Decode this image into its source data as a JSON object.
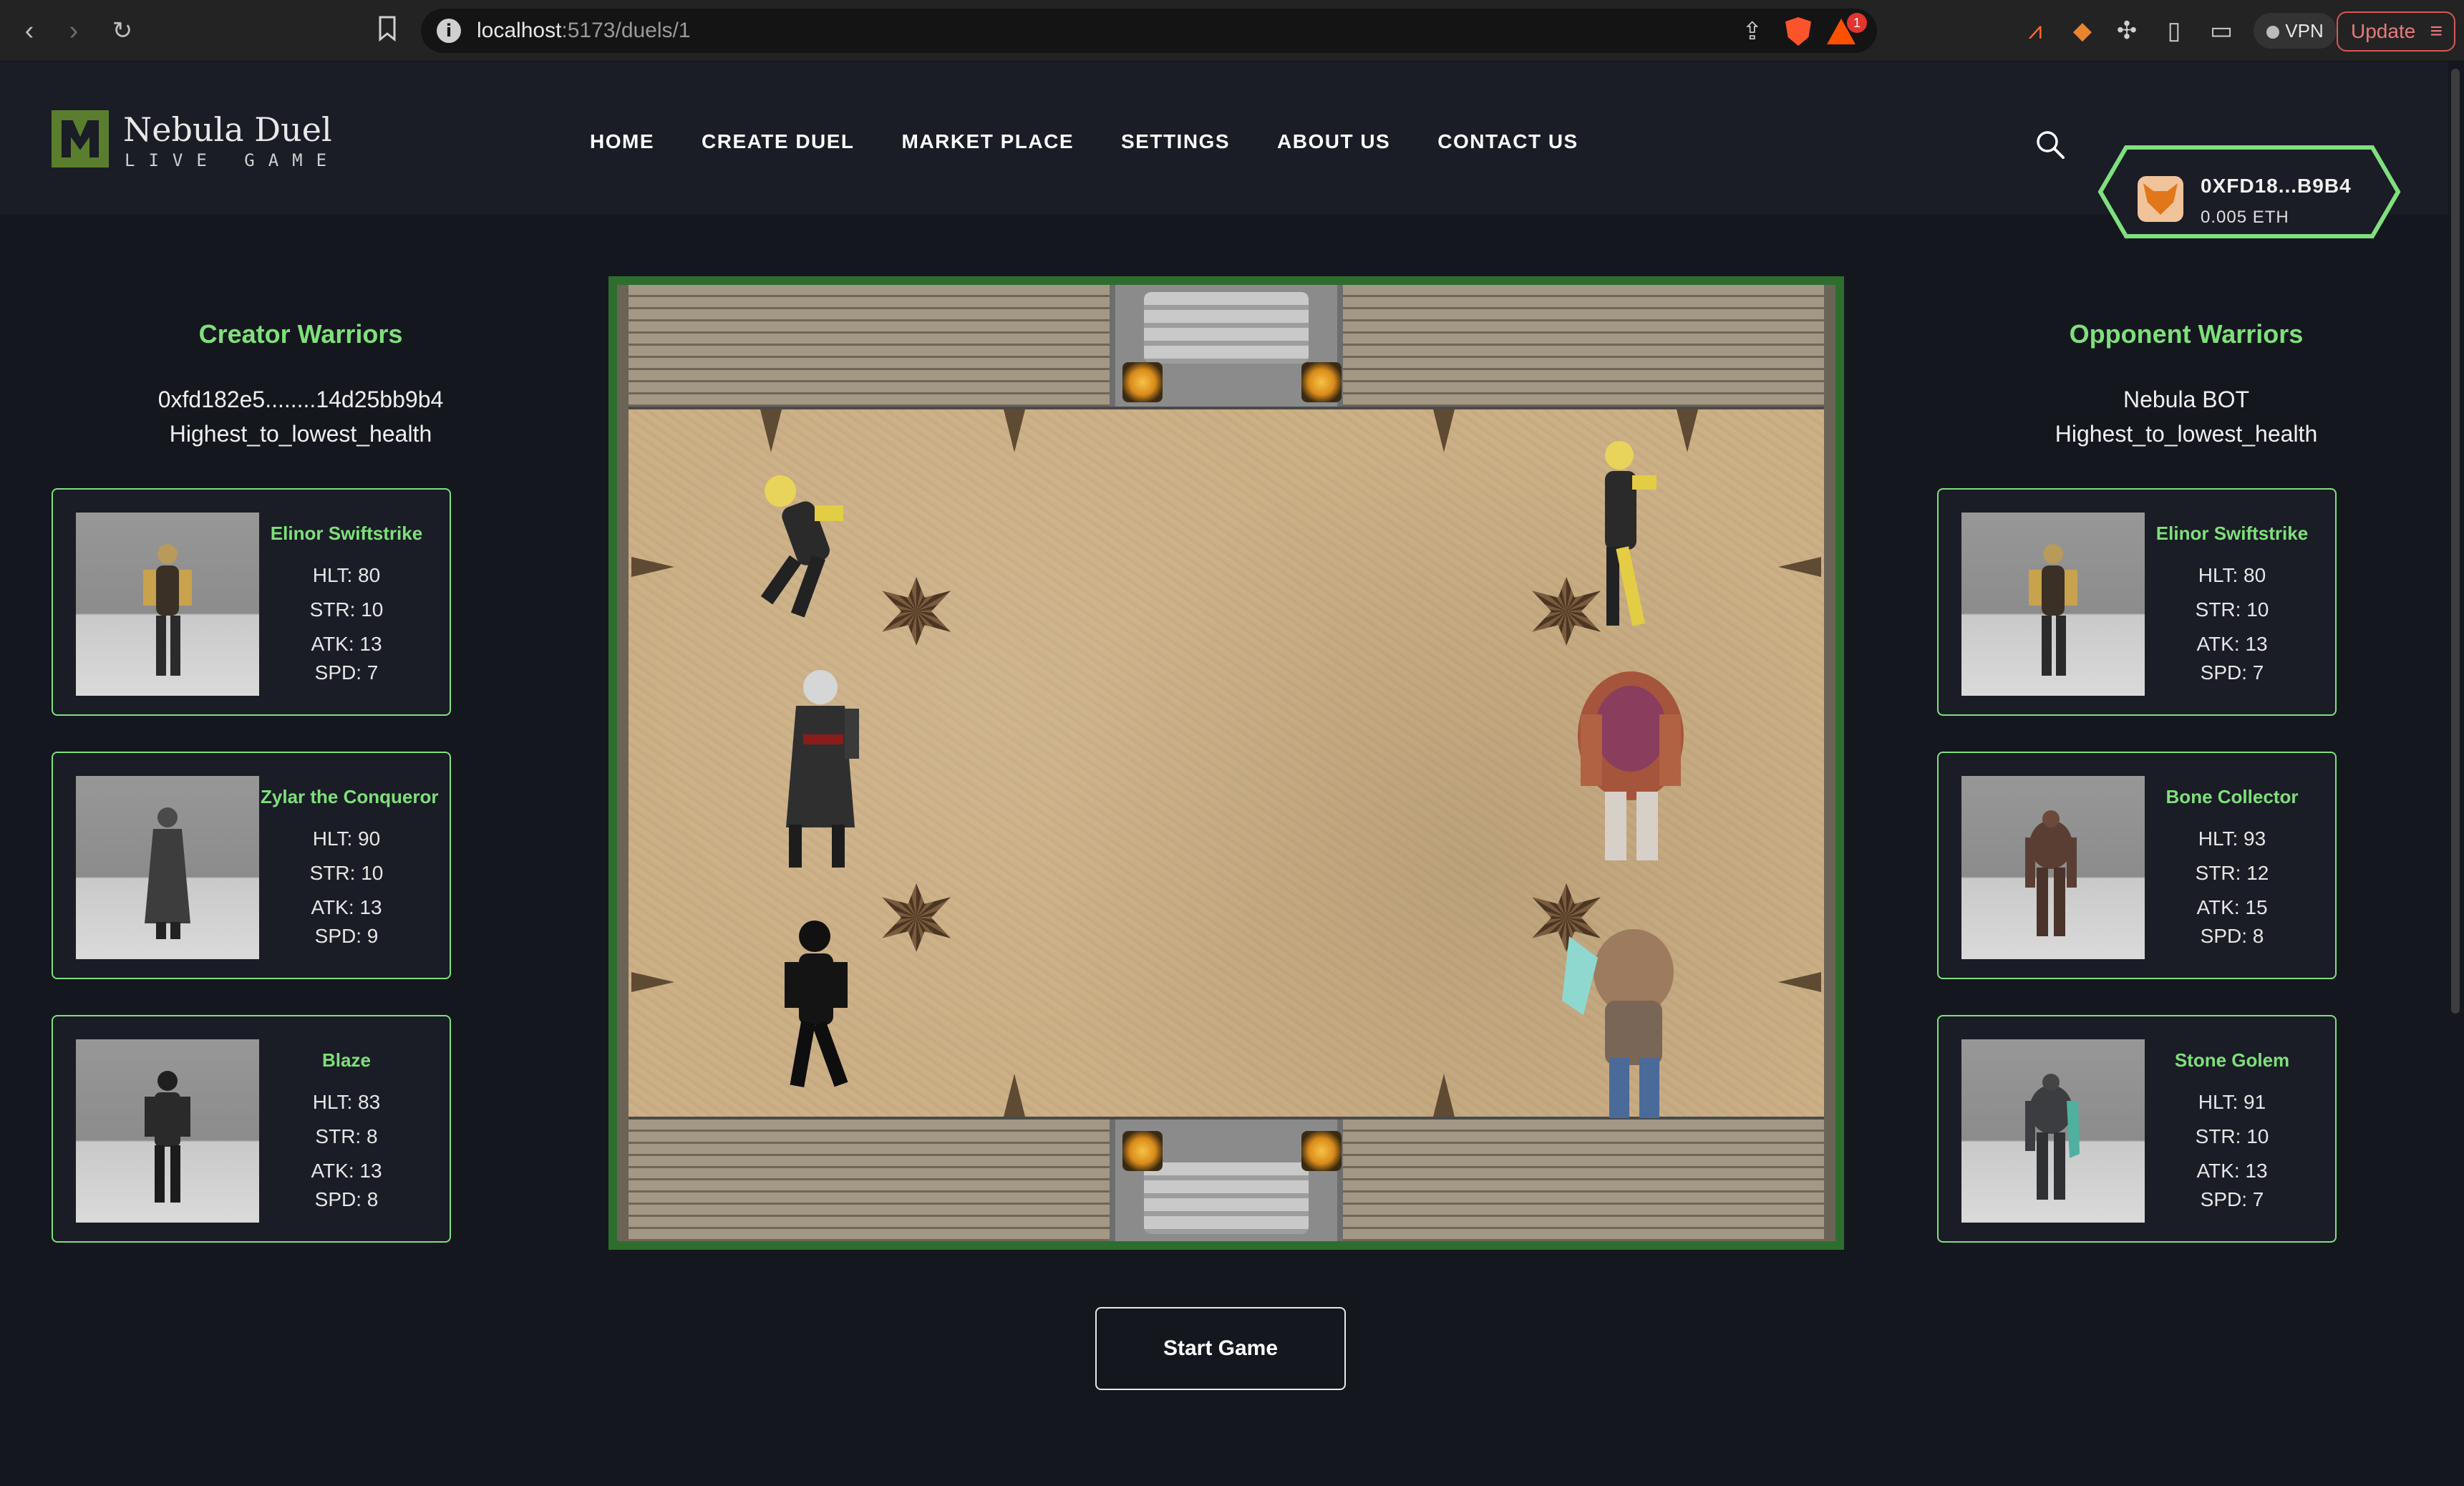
{
  "browser": {
    "url_host": "localhost",
    "url_path": ":5173/duels/1",
    "bat_badge": "1",
    "vpn_label": "VPN",
    "update_label": "Update"
  },
  "header": {
    "logo_name": "Nebula Duel",
    "logo_tagline": "LIVE GAME",
    "nav": [
      "HOME",
      "CREATE DUEL",
      "MARKET PLACE",
      "SETTINGS",
      "ABOUT US",
      "CONTACT US"
    ],
    "wallet_address": "0XFD18...B9B4",
    "wallet_balance": "0.005 ETH"
  },
  "creator": {
    "title": "Creator Warriors",
    "owner": "0xfd182e5........14d25bb9b4",
    "strategy": "Highest_to_lowest_health",
    "warriors": [
      {
        "name": "Elinor Swiftstrike",
        "hlt": "HLT: 80",
        "str": "STR: 10",
        "atk": "ATK: 13",
        "spd": "SPD: 7"
      },
      {
        "name": "Zylar the Conqueror",
        "hlt": "HLT: 90",
        "str": "STR: 10",
        "atk": "ATK: 13",
        "spd": "SPD: 9"
      },
      {
        "name": "Blaze",
        "hlt": "HLT: 83",
        "str": "STR: 8",
        "atk": "ATK: 13",
        "spd": "SPD: 8"
      }
    ]
  },
  "opponent": {
    "title": "Opponent Warriors",
    "owner": "Nebula BOT",
    "strategy": "Highest_to_lowest_health",
    "warriors": [
      {
        "name": "Elinor Swiftstrike",
        "hlt": "HLT: 80",
        "str": "STR: 10",
        "atk": "ATK: 13",
        "spd": "SPD: 7"
      },
      {
        "name": "Bone Collector",
        "hlt": "HLT: 93",
        "str": "STR: 12",
        "atk": "ATK: 15",
        "spd": "SPD: 8"
      },
      {
        "name": "Stone Golem",
        "hlt": "HLT: 91",
        "str": "STR: 10",
        "atk": "ATK: 13",
        "spd": "SPD: 7"
      }
    ]
  },
  "start_button": "Start Game",
  "colors": {
    "accent_green": "#7ee07a",
    "arena_border": "#2d6e2e",
    "background": "#15171f"
  }
}
